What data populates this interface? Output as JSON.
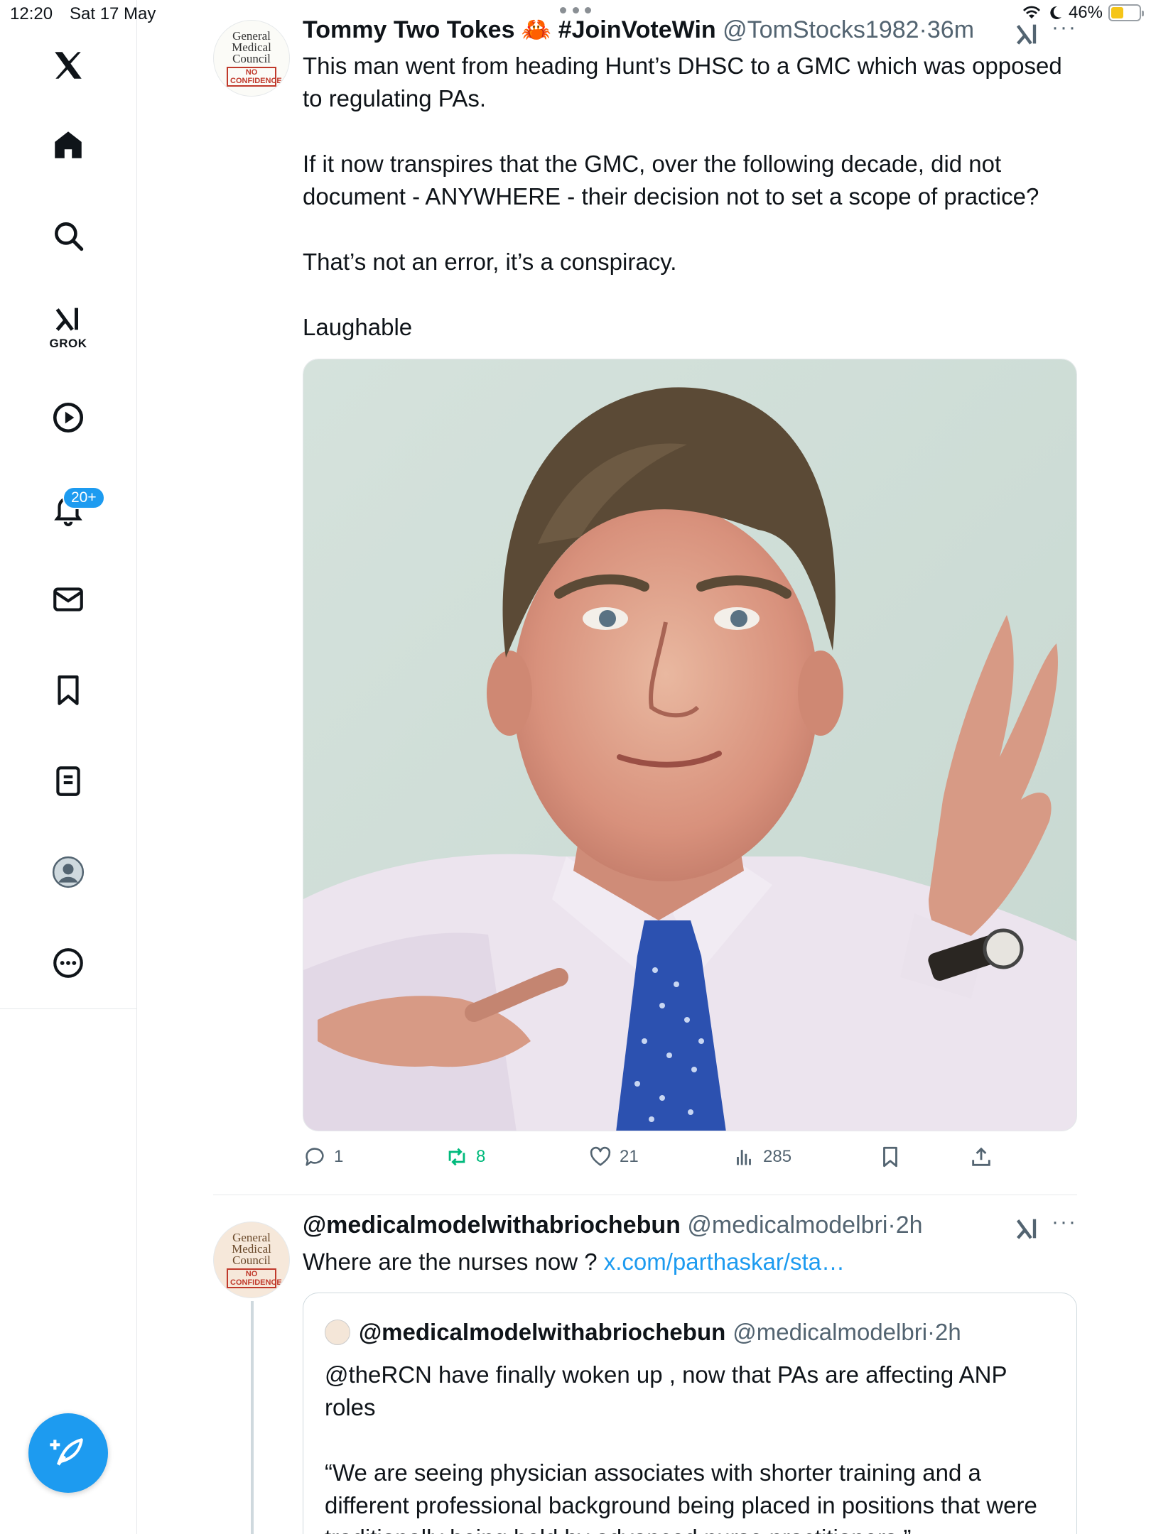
{
  "status_bar": {
    "time": "12:20",
    "date": "Sat 17 May",
    "battery": "46%"
  },
  "sidebar": {
    "grok_label": "GROK",
    "notifications_badge": "20+"
  },
  "tweet1": {
    "name": "Tommy Two Tokes 🦀 #JoinVoteWin",
    "handle": "@TomStocks1982",
    "time": "36m",
    "avatar_text": "General Medical Council",
    "avatar_stamp": "NO CONFIDENCE",
    "paragraphs": [
      "This man went from heading Hunt’s DHSC to a GMC which was opposed to regulating PAs.",
      "If it now transpires that the GMC, over the following decade, did not document - ANYWHERE - their decision not to set a scope of practice?",
      "That’s not an error, it’s a conspiracy.",
      "Laughable"
    ],
    "actions": {
      "replies": "1",
      "reposts": "8",
      "likes": "21",
      "views": "285"
    }
  },
  "tweet2": {
    "name": "@medicalmodelwithabriochebun",
    "handle": "@medicalmodelbri",
    "time": "2h",
    "text": "Where are the nurses now ? ",
    "link": "x.com/parthaskar/sta…",
    "quote": {
      "name": "@medicalmodelwithabriochebun",
      "handle": "@medicalmodelbri",
      "time": "2h",
      "paragraphs": [
        "@theRCN have finally woken up , now that PAs are affecting ANP roles",
        "“We are seeing physician associates with shorter training and a different professional background being placed in positions that were traditionally being held by advanced nurse practitioners.”"
      ]
    }
  },
  "colors": {
    "accent": "#1d9bf0",
    "repost_green": "#00ba7c",
    "muted": "#536471",
    "text": "#0f1419"
  },
  "icons": [
    "x-logo-icon",
    "home-icon",
    "search-icon",
    "grok-icon",
    "video-icon",
    "bell-icon",
    "mail-icon",
    "bookmark-icon",
    "list-icon",
    "profile-icon",
    "more-icon",
    "compose-icon",
    "reply-icon",
    "repost-icon",
    "like-icon",
    "views-icon",
    "share-icon"
  ]
}
